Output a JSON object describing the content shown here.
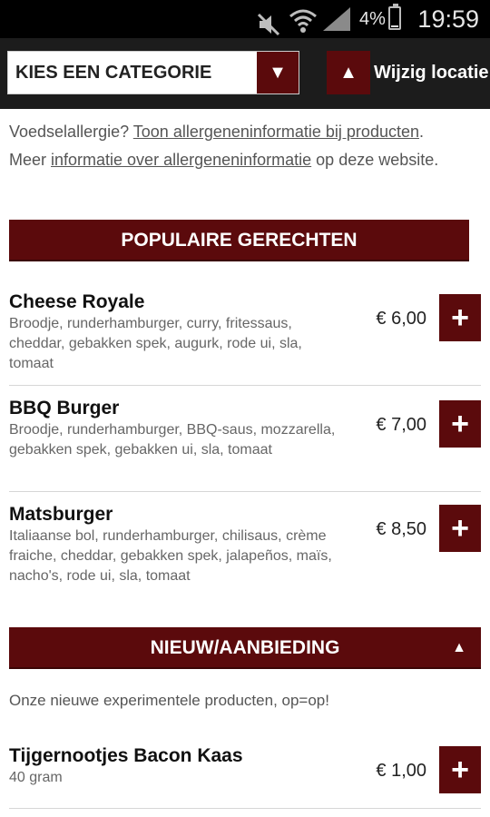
{
  "status_bar": {
    "time": "19:59",
    "battery": "4%",
    "icons": [
      "mute-icon",
      "wifi-icon",
      "signal-icon",
      "battery-icon"
    ]
  },
  "header": {
    "category_select": "KIES EEN CATEGORIE",
    "category_arrow": "▼",
    "location_arrow": "▲",
    "location_label": "Wijzig locatie"
  },
  "info": {
    "line1_prefix": "Voedselallergie? ",
    "line1_link": "Toon allergeneninformatie bij producten",
    "line1_suffix": ".",
    "line2_prefix": "Meer ",
    "line2_link": "informatie over allergeneninformatie",
    "line2_suffix": " op deze website."
  },
  "sections": [
    {
      "title": "POPULAIRE GERECHTEN",
      "items": [
        {
          "name": "Cheese Royale",
          "desc": "Broodje, runderhamburger, curry, fritessaus, cheddar, gebakken spek, augurk, rode ui, sla, tomaat",
          "price": "€ 6,00",
          "add": "+"
        },
        {
          "name": "BBQ Burger",
          "desc": "Broodje, runderhamburger, BBQ-saus, mozzarella, gebakken spek, gebakken ui, sla, tomaat",
          "price": "€ 7,00",
          "add": "+"
        },
        {
          "name": "Matsburger",
          "desc": "Italiaanse bol, runderhamburger, chilisaus, crème fraiche, cheddar, gebakken spek, jalapeños, maïs, nacho's, rode ui, sla, tomaat",
          "price": "€ 8,50",
          "add": "+"
        }
      ]
    },
    {
      "title": "NIEUW/AANBIEDING",
      "arrow": "▲",
      "intro": "Onze nieuwe experimentele producten, op=op!",
      "items": [
        {
          "name": "Tijgernootjes Bacon Kaas",
          "desc": "40 gram",
          "price": "€ 1,00",
          "add": "+"
        }
      ]
    }
  ],
  "colors": {
    "accent": "#5b0a0c",
    "header_bg": "#1c1c1c",
    "status_bg": "#000000"
  }
}
